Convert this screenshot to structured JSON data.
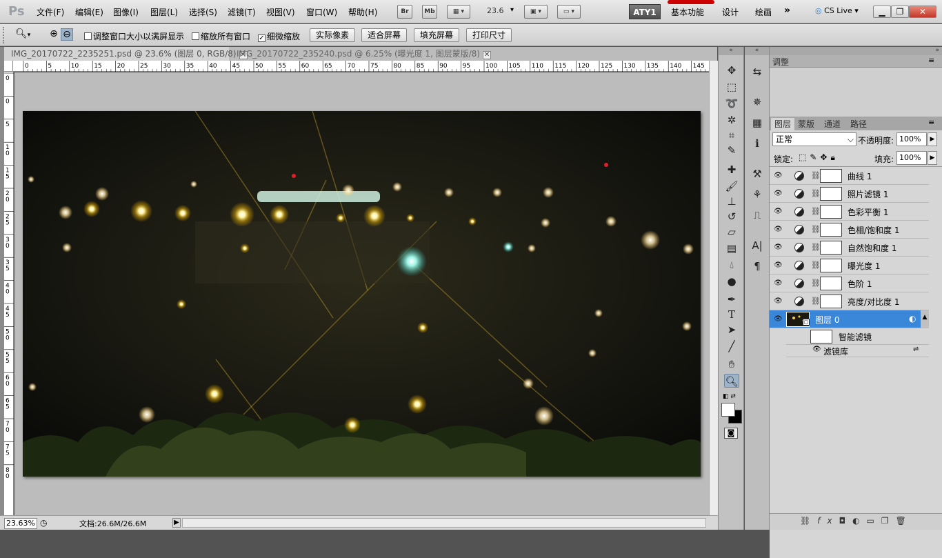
{
  "menubar": {
    "logo": "Ps",
    "menus": [
      "文件(F)",
      "编辑(E)",
      "图像(I)",
      "图层(L)",
      "选择(S)",
      "滤镜(T)",
      "视图(V)",
      "窗口(W)",
      "帮助(H)"
    ],
    "bridge": "Br",
    "minibridge": "Mb",
    "zoom": "23.6",
    "workspace_active": "ATY1",
    "workspaces": [
      "基本功能",
      "设计",
      "绘画"
    ],
    "more": "»",
    "cslive": "CS Live"
  },
  "options": {
    "checkboxes": [
      {
        "label": "调整窗口大小以满屏显示",
        "checked": false
      },
      {
        "label": "缩放所有窗口",
        "checked": false
      },
      {
        "label": "细微缩放",
        "checked": true
      }
    ],
    "buttons": [
      "实际像素",
      "适合屏幕",
      "填充屏幕",
      "打印尺寸"
    ]
  },
  "tabs": [
    {
      "label": "IMG_20170722_2235251.psd @ 23.6% (图层 0, RGB/8)",
      "active": true
    },
    {
      "label": "IMG_20170722_235240.psd @ 6.25% (曝光度 1, 图层蒙版/8)",
      "active": false
    }
  ],
  "ruler_h": [
    "0",
    "5",
    "10",
    "15",
    "20",
    "25",
    "30",
    "35",
    "40",
    "45",
    "50",
    "55",
    "60",
    "65",
    "70",
    "75",
    "80",
    "85",
    "90",
    "95",
    "100",
    "105",
    "110",
    "115",
    "120",
    "125",
    "130",
    "135",
    "140",
    "145"
  ],
  "ruler_v": [
    "0",
    "0",
    "5",
    "1\n0",
    "1\n5",
    "2\n0",
    "2\n5",
    "3\n0",
    "3\n5",
    "4\n0",
    "4\n5",
    "5\n0",
    "5\n5",
    "6\n0",
    "6\n5",
    "7\n0",
    "7\n5",
    "8\n0"
  ],
  "status": {
    "zoom": "23.63%",
    "doc": "文档:26.6M/26.6M"
  },
  "panel": {
    "adjust_title": "调整",
    "tabs": [
      "图层",
      "蒙版",
      "通道",
      "路径"
    ],
    "blend_mode": "正常",
    "opacity_label": "不透明度:",
    "opacity": "100%",
    "lock_label": "锁定:",
    "fill_label": "填充:",
    "fill": "100%",
    "layers": [
      "曲线 1",
      "照片滤镜 1",
      "色彩平衡 1",
      "色相/饱和度 1",
      "自然饱和度 1",
      "曝光度 1",
      "色阶 1",
      "亮度/对比度 1"
    ],
    "base_layer": "图层 0",
    "smart_filter": "智能滤镜",
    "filter_gallery": "滤镜库"
  },
  "colors": {
    "selection": "#3a86d8",
    "accent": "#2a7fd4"
  }
}
